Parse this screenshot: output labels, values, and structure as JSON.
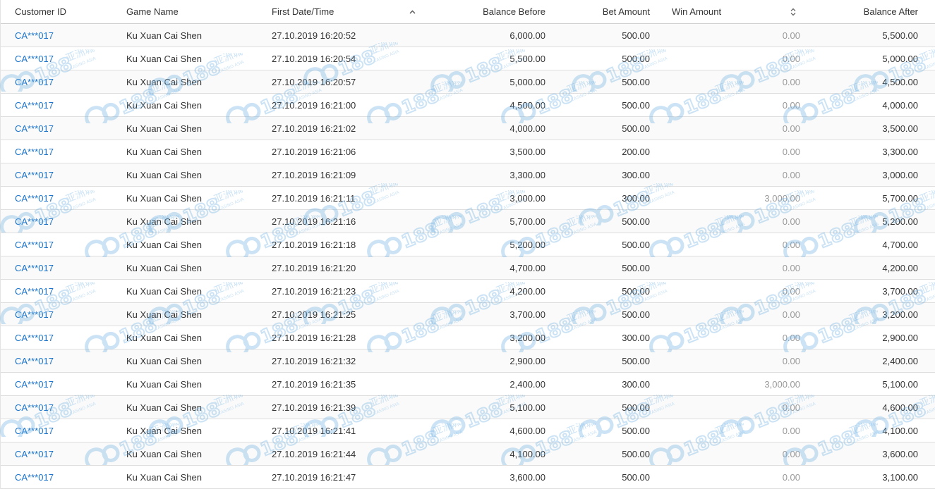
{
  "table": {
    "columns": {
      "customer_id": "Customer ID",
      "game_name": "Game Name",
      "first_datetime": "First Date/Time",
      "balance_before": "Balance Before",
      "bet_amount": "Bet Amount",
      "win_amount": "Win Amount",
      "balance_after": "Balance After"
    },
    "sort_icons": {
      "date": "sort-ascending-icon",
      "win": "sort-both-icon"
    },
    "rows": [
      {
        "customer_id": "CA***017",
        "game_name": "Ku Xuan Cai Shen",
        "datetime": "27.10.2019 16:20:52",
        "balance_before": "6,000.00",
        "bet": "500.00",
        "win": "0.00",
        "balance_after": "5,500.00"
      },
      {
        "customer_id": "CA***017",
        "game_name": "Ku Xuan Cai Shen",
        "datetime": "27.10.2019 16:20:54",
        "balance_before": "5,500.00",
        "bet": "500.00",
        "win": "0.00",
        "balance_after": "5,000.00"
      },
      {
        "customer_id": "CA***017",
        "game_name": "Ku Xuan Cai Shen",
        "datetime": "27.10.2019 16:20:57",
        "balance_before": "5,000.00",
        "bet": "500.00",
        "win": "0.00",
        "balance_after": "4,500.00"
      },
      {
        "customer_id": "CA***017",
        "game_name": "Ku Xuan Cai Shen",
        "datetime": "27.10.2019 16:21:00",
        "balance_before": "4,500.00",
        "bet": "500.00",
        "win": "0.00",
        "balance_after": "4,000.00"
      },
      {
        "customer_id": "CA***017",
        "game_name": "Ku Xuan Cai Shen",
        "datetime": "27.10.2019 16:21:02",
        "balance_before": "4,000.00",
        "bet": "500.00",
        "win": "0.00",
        "balance_after": "3,500.00"
      },
      {
        "customer_id": "CA***017",
        "game_name": "Ku Xuan Cai Shen",
        "datetime": "27.10.2019 16:21:06",
        "balance_before": "3,500.00",
        "bet": "200.00",
        "win": "0.00",
        "balance_after": "3,300.00"
      },
      {
        "customer_id": "CA***017",
        "game_name": "Ku Xuan Cai Shen",
        "datetime": "27.10.2019 16:21:09",
        "balance_before": "3,300.00",
        "bet": "300.00",
        "win": "0.00",
        "balance_after": "3,000.00"
      },
      {
        "customer_id": "CA***017",
        "game_name": "Ku Xuan Cai Shen",
        "datetime": "27.10.2019 16:21:11",
        "balance_before": "3,000.00",
        "bet": "300.00",
        "win": "3,000.00",
        "balance_after": "5,700.00"
      },
      {
        "customer_id": "CA***017",
        "game_name": "Ku Xuan Cai Shen",
        "datetime": "27.10.2019 16:21:16",
        "balance_before": "5,700.00",
        "bet": "500.00",
        "win": "0.00",
        "balance_after": "5,200.00"
      },
      {
        "customer_id": "CA***017",
        "game_name": "Ku Xuan Cai Shen",
        "datetime": "27.10.2019 16:21:18",
        "balance_before": "5,200.00",
        "bet": "500.00",
        "win": "0.00",
        "balance_after": "4,700.00"
      },
      {
        "customer_id": "CA***017",
        "game_name": "Ku Xuan Cai Shen",
        "datetime": "27.10.2019 16:21:20",
        "balance_before": "4,700.00",
        "bet": "500.00",
        "win": "0.00",
        "balance_after": "4,200.00"
      },
      {
        "customer_id": "CA***017",
        "game_name": "Ku Xuan Cai Shen",
        "datetime": "27.10.2019 16:21:23",
        "balance_before": "4,200.00",
        "bet": "500.00",
        "win": "0.00",
        "balance_after": "3,700.00"
      },
      {
        "customer_id": "CA***017",
        "game_name": "Ku Xuan Cai Shen",
        "datetime": "27.10.2019 16:21:25",
        "balance_before": "3,700.00",
        "bet": "500.00",
        "win": "0.00",
        "balance_after": "3,200.00"
      },
      {
        "customer_id": "CA***017",
        "game_name": "Ku Xuan Cai Shen",
        "datetime": "27.10.2019 16:21:28",
        "balance_before": "3,200.00",
        "bet": "300.00",
        "win": "0.00",
        "balance_after": "2,900.00"
      },
      {
        "customer_id": "CA***017",
        "game_name": "Ku Xuan Cai Shen",
        "datetime": "27.10.2019 16:21:32",
        "balance_before": "2,900.00",
        "bet": "500.00",
        "win": "0.00",
        "balance_after": "2,400.00"
      },
      {
        "customer_id": "CA***017",
        "game_name": "Ku Xuan Cai Shen",
        "datetime": "27.10.2019 16:21:35",
        "balance_before": "2,400.00",
        "bet": "300.00",
        "win": "3,000.00",
        "balance_after": "5,100.00"
      },
      {
        "customer_id": "CA***017",
        "game_name": "Ku Xuan Cai Shen",
        "datetime": "27.10.2019 16:21:39",
        "balance_before": "5,100.00",
        "bet": "500.00",
        "win": "0.00",
        "balance_after": "4,600.00"
      },
      {
        "customer_id": "CA***017",
        "game_name": "Ku Xuan Cai Shen",
        "datetime": "27.10.2019 16:21:41",
        "balance_before": "4,600.00",
        "bet": "500.00",
        "win": "0.00",
        "balance_after": "4,100.00"
      },
      {
        "customer_id": "CA***017",
        "game_name": "Ku Xuan Cai Shen",
        "datetime": "27.10.2019 16:21:44",
        "balance_before": "4,100.00",
        "bet": "500.00",
        "win": "0.00",
        "balance_after": "3,600.00"
      },
      {
        "customer_id": "CA***017",
        "game_name": "Ku Xuan Cai Shen",
        "datetime": "27.10.2019 16:21:47",
        "balance_before": "3,600.00",
        "bet": "500.00",
        "win": "0.00",
        "balance_after": "3,100.00"
      }
    ]
  },
  "watermark": {
    "brand": "CO188",
    "chinese": "亚洲城",
    "subtitle": "CASINO ASIA",
    "color": "#6fb1e3"
  },
  "colors": {
    "link": "#1a73c8",
    "muted": "#9a9a9a",
    "row_alt": "#fafafa"
  }
}
